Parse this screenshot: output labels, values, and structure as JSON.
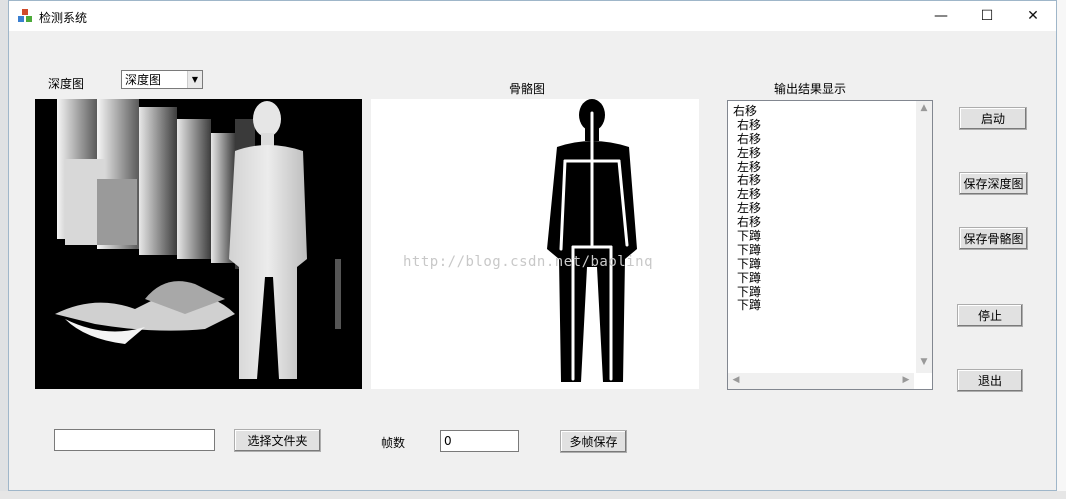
{
  "window": {
    "title": "检测系统",
    "minimize": "—",
    "maximize": "☐",
    "close": "✕"
  },
  "depth": {
    "label": "深度图",
    "combo_value": "深度图"
  },
  "skeleton": {
    "label": "骨骼图",
    "watermark": "http://blog.csdn.net/baolinq"
  },
  "output": {
    "label": "输出结果显示",
    "items": [
      "右移",
      "右移",
      "右移",
      "左移",
      "左移",
      "右移",
      "左移",
      "左移",
      "右移",
      "下蹲",
      "下蹲",
      "下蹲",
      "下蹲",
      "下蹲",
      "下蹲"
    ]
  },
  "buttons": {
    "start": "启动",
    "save_depth": "保存深度图",
    "save_skeleton": "保存骨骼图",
    "stop": "停止",
    "exit": "退出",
    "select_folder": "选择文件夹",
    "multi_save": "多帧保存"
  },
  "folder_input": {
    "value": ""
  },
  "frames": {
    "label": "帧数",
    "value": "0"
  }
}
